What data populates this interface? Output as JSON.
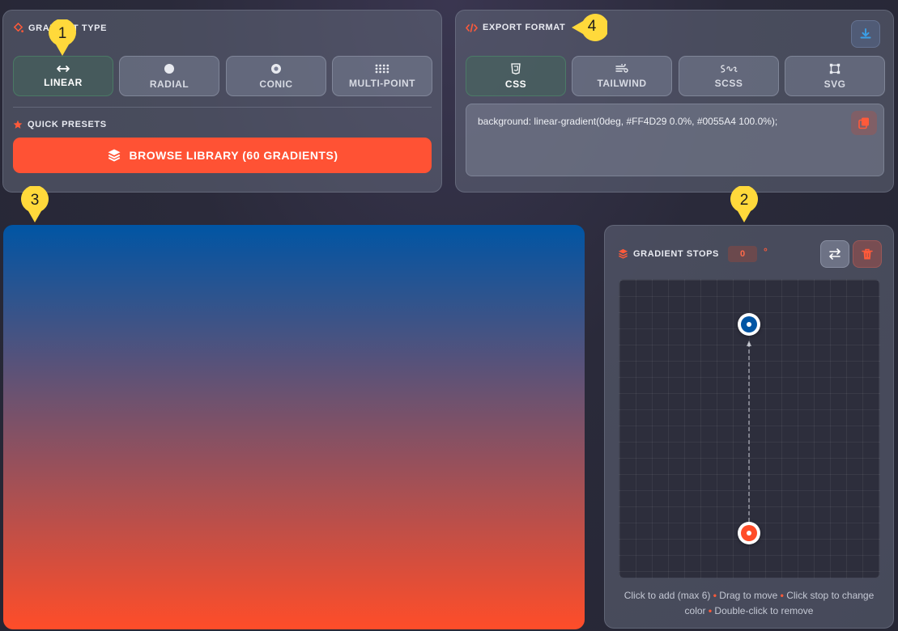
{
  "gradient_type": {
    "label": "GRADIENT TYPE",
    "options": [
      {
        "label": "LINEAR",
        "icon": "arrows-horizontal-icon",
        "active": true
      },
      {
        "label": "RADIAL",
        "icon": "circle-icon",
        "active": false
      },
      {
        "label": "CONIC",
        "icon": "conic-icon",
        "active": false
      },
      {
        "label": "MULTI-POINT",
        "icon": "dot-grid-icon",
        "active": false
      }
    ]
  },
  "quick_presets": {
    "label": "QUICK PRESETS",
    "browse_label": "BROWSE LIBRARY (60 GRADIENTS)"
  },
  "export_format": {
    "label": "EXPORT FORMAT",
    "options": [
      {
        "label": "CSS",
        "icon": "css-icon",
        "active": true
      },
      {
        "label": "TAILWIND",
        "icon": "wind-icon",
        "active": false
      },
      {
        "label": "SCSS",
        "icon": "sass-icon",
        "active": false
      },
      {
        "label": "SVG",
        "icon": "vector-square-icon",
        "active": false
      }
    ],
    "code": "background: linear-gradient(0deg, #FF4D29 0.0%, #0055A4 100.0%);"
  },
  "gradient_stops": {
    "label": "GRADIENT STOPS",
    "angle_value": "0",
    "angle_unit": "°",
    "stops": [
      {
        "color": "#0055A4",
        "position": 100.0
      },
      {
        "color": "#FF4D29",
        "position": 0.0
      }
    ],
    "help": {
      "part1": "Click to add (max 6)",
      "part2": "Drag to move",
      "part3": "Click stop to change color",
      "part4": "Double-click to remove",
      "separator": "•"
    }
  },
  "preview": {
    "angle_deg": 0,
    "color_start": "#FF4D29",
    "color_end": "#0055A4"
  },
  "annotations": [
    {
      "number": "1"
    },
    {
      "number": "2"
    },
    {
      "number": "3"
    },
    {
      "number": "4"
    }
  ],
  "colors": {
    "accent": "#FF5234",
    "panel": "#62687A",
    "badge": "#FFD93B"
  }
}
